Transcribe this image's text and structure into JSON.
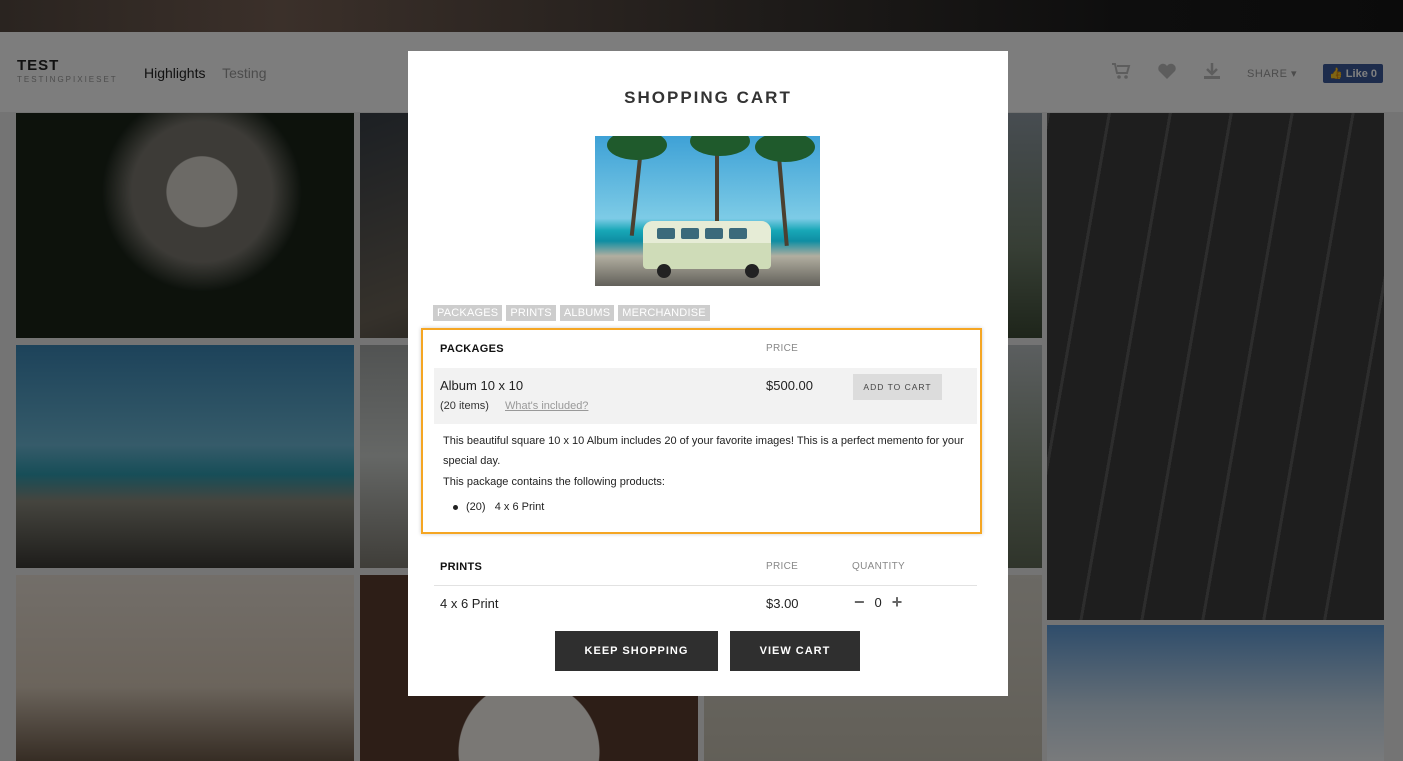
{
  "site": {
    "title": "TEST",
    "subtitle": "TESTINGPIXIESET",
    "nav": [
      "Highlights",
      "Testing"
    ],
    "share_label": "SHARE ▾",
    "fb_like_label": "Like",
    "fb_like_count": "0"
  },
  "modal": {
    "title": "SHOPPING CART",
    "tabs": [
      "PACKAGES",
      "PRINTS",
      "ALBUMS",
      "MERCHANDISE"
    ],
    "packages": {
      "heading": "PACKAGES",
      "price_header": "PRICE",
      "item": {
        "name": "Album 10 x 10",
        "count": "(20 items)",
        "whats_included": "What's included?",
        "price": "$500.00",
        "add_button": "ADD TO CART",
        "description": "This beautiful square 10 x 10 Album includes 20 of your favorite images! This is a perfect memento for your special day.",
        "contains_text": "This package contains the following products:",
        "products": [
          {
            "qty": "(20)",
            "name": "4 x 6 Print"
          }
        ]
      }
    },
    "prints": {
      "heading": "PRINTS",
      "price_header": "PRICE",
      "quantity_header": "QUANTITY",
      "item": {
        "name": "4 x 6 Print",
        "price": "$3.00",
        "quantity": "0"
      }
    },
    "buttons": {
      "keep_shopping": "KEEP SHOPPING",
      "view_cart": "VIEW CART"
    }
  },
  "icons": [
    "cart-icon",
    "heart-icon",
    "download-icon",
    "minus-icon",
    "plus-icon"
  ],
  "colors": {
    "highlight_border": "#f5a623",
    "dark_button": "#2f2f2f",
    "fb_blue": "#3b5998"
  }
}
